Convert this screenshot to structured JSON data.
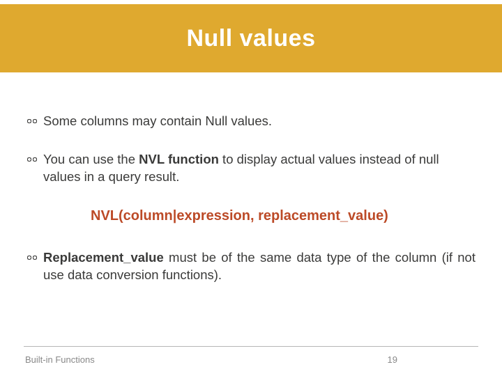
{
  "title": "Null values",
  "bullets": [
    {
      "text_before": "Some columns may contain Null values.",
      "bold": "",
      "text_after": ""
    },
    {
      "text_before": "You can use the ",
      "bold": "NVL function",
      "text_after": " to display actual values instead of null values in a query result."
    }
  ],
  "syntax": "NVL(column|expression, replacement_value)",
  "bullet3": {
    "bold": "Replacement_value",
    "rest": " must be of the same data type of the column (if not use data conversion functions)."
  },
  "footer": {
    "left": "Built-in Functions",
    "page": "19"
  }
}
